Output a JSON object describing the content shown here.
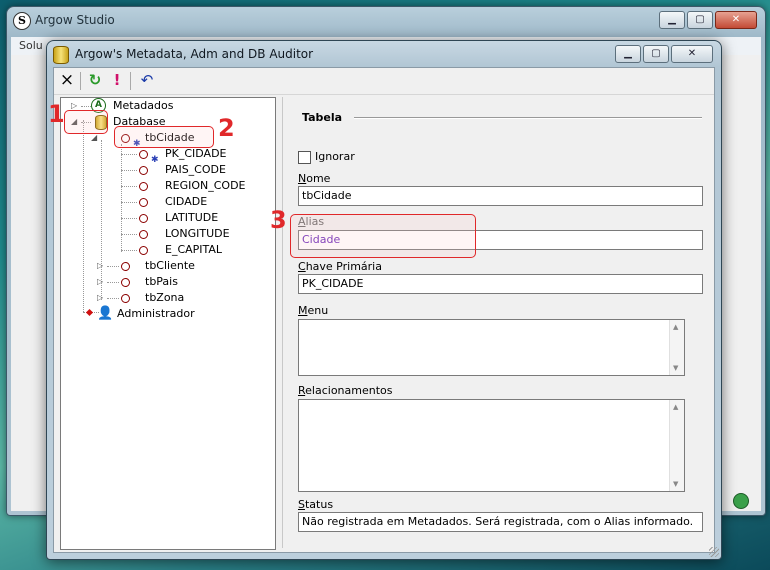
{
  "background_window": {
    "title": "Argow Studio",
    "menu_fragment": "Solu",
    "app_icon_letter": "S"
  },
  "dialog": {
    "title": "Argow's Metadata, Adm and DB Auditor",
    "toolbar": {
      "close_icon": "×",
      "refresh_icon": "↻",
      "alert_icon": "!",
      "undo_icon": "↶"
    },
    "tree": {
      "metadados": "Metadados",
      "database": "Database",
      "tbcidade": "tbCidade",
      "columns": [
        "PK_CIDADE",
        "PAIS_CODE",
        "REGION_CODE",
        "CIDADE",
        "LATITUDE",
        "LONGITUDE",
        "E_CAPITAL"
      ],
      "tbcliente": "tbCliente",
      "tbpais": "tbPais",
      "tbzona": "tbZona",
      "administrador": "Administrador"
    },
    "form": {
      "group_title": "Tabela",
      "ignorar_label": "Ignorar",
      "ignorar_checked": false,
      "nome_label_u": "N",
      "nome_label_rest": "ome",
      "nome_value": "tbCidade",
      "alias_label_u": "A",
      "alias_label_rest": "lias",
      "alias_value": "Cidade",
      "chave_label_u": "C",
      "chave_label_rest": "have Primária",
      "chave_value": "PK_CIDADE",
      "menu_label_u": "M",
      "menu_label_rest": "enu",
      "menu_value": "",
      "relac_label_u": "R",
      "relac_label_rest": "elacionamentos",
      "relac_value": "",
      "status_label_u": "S",
      "status_label_rest": "tatus",
      "status_value": "Não registrada em Metadados. Será registrada, com o Alias informado."
    }
  },
  "annotations": [
    "1",
    "2",
    "3"
  ],
  "colors": {
    "annotation": "#e0282a",
    "alias_text": "#6a28b8"
  }
}
